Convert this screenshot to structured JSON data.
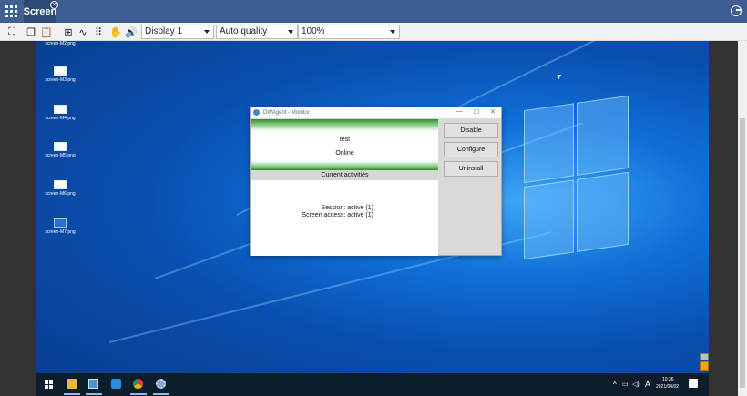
{
  "app": {
    "tab_label": "Screen"
  },
  "toolbar": {
    "display_select": "Display 1",
    "quality_select": "Auto quality",
    "zoom_select": "100%"
  },
  "desktop": {
    "icons": [
      {
        "label": "screen-M2.png"
      },
      {
        "label": "screen-M3.png"
      },
      {
        "label": "screen-M4.png"
      },
      {
        "label": "screen-M5.png"
      },
      {
        "label": "screen-M6.png"
      },
      {
        "label": "screen-M7.png"
      }
    ]
  },
  "agent_window": {
    "title": "DWAgent - Monitor",
    "name": "test",
    "status": "Online",
    "activities_header": "Current activities",
    "activity_lines": [
      "Session: active (1)",
      "Screen access: active (1)"
    ],
    "buttons": {
      "disable": "Disable",
      "configure": "Configure",
      "uninstall": "Uninstall"
    }
  },
  "taskbar": {
    "time": "10:36",
    "date": "2021/04/02",
    "lang": "A"
  },
  "colors": {
    "topbar": "#3f5f93",
    "tab_active": "#2d4a77",
    "desktop_blue": "#0a4fb0",
    "band_green": "#2d8e2d"
  }
}
